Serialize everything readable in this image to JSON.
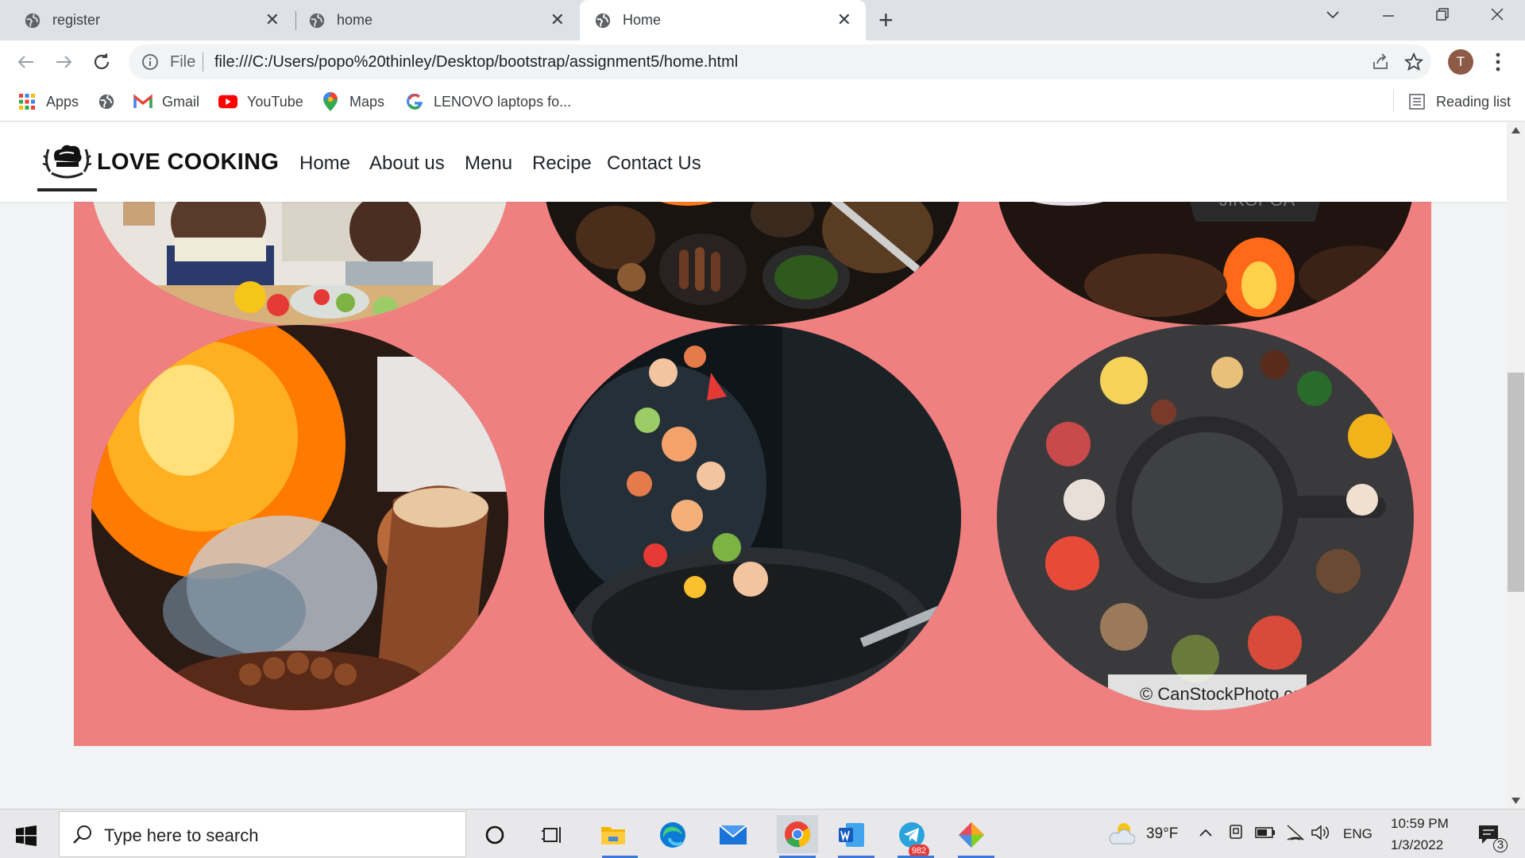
{
  "browser": {
    "tabs": [
      {
        "title": "register",
        "active": false
      },
      {
        "title": "home",
        "active": false
      },
      {
        "title": "Home",
        "active": true
      }
    ],
    "address": {
      "scheme_label": "File",
      "url": "file:///C:/Users/popo%20thinley/Desktop/bootstrap/assignment5/home.html"
    },
    "profile_initial": "T",
    "bookmarks": [
      {
        "label": "Apps",
        "icon": "apps-grid-icon"
      },
      {
        "label": "",
        "icon": "globe-icon"
      },
      {
        "label": "Gmail",
        "icon": "gmail-icon"
      },
      {
        "label": "YouTube",
        "icon": "youtube-icon"
      },
      {
        "label": "Maps",
        "icon": "maps-icon"
      },
      {
        "label": "LENOVO laptops fo...",
        "icon": "google-icon"
      }
    ],
    "reading_list": "Reading list"
  },
  "site": {
    "brand": "LOVE COOKING",
    "nav": [
      "Home",
      "About us",
      "Menu",
      "Recipe",
      "Contact Us"
    ],
    "gallery_bg": "#f08080",
    "watermark": "© CanStockPhoto.com",
    "photos": [
      {
        "subject": "kids-cooking"
      },
      {
        "subject": "grilled-meats"
      },
      {
        "subject": "campfire-pot"
      },
      {
        "subject": "flambe-fire"
      },
      {
        "subject": "wok-toss-seafood"
      },
      {
        "subject": "cast-iron-pan-ingredients"
      }
    ]
  },
  "taskbar": {
    "search_placeholder": "Type here to search",
    "weather": "39°F",
    "language": "ENG",
    "time": "10:59 PM",
    "date": "1/3/2022",
    "telegram_badge": "982",
    "notifications": "3"
  },
  "colors": {
    "accent": "#3c78d8",
    "tab_strip": "#dee1e6"
  }
}
